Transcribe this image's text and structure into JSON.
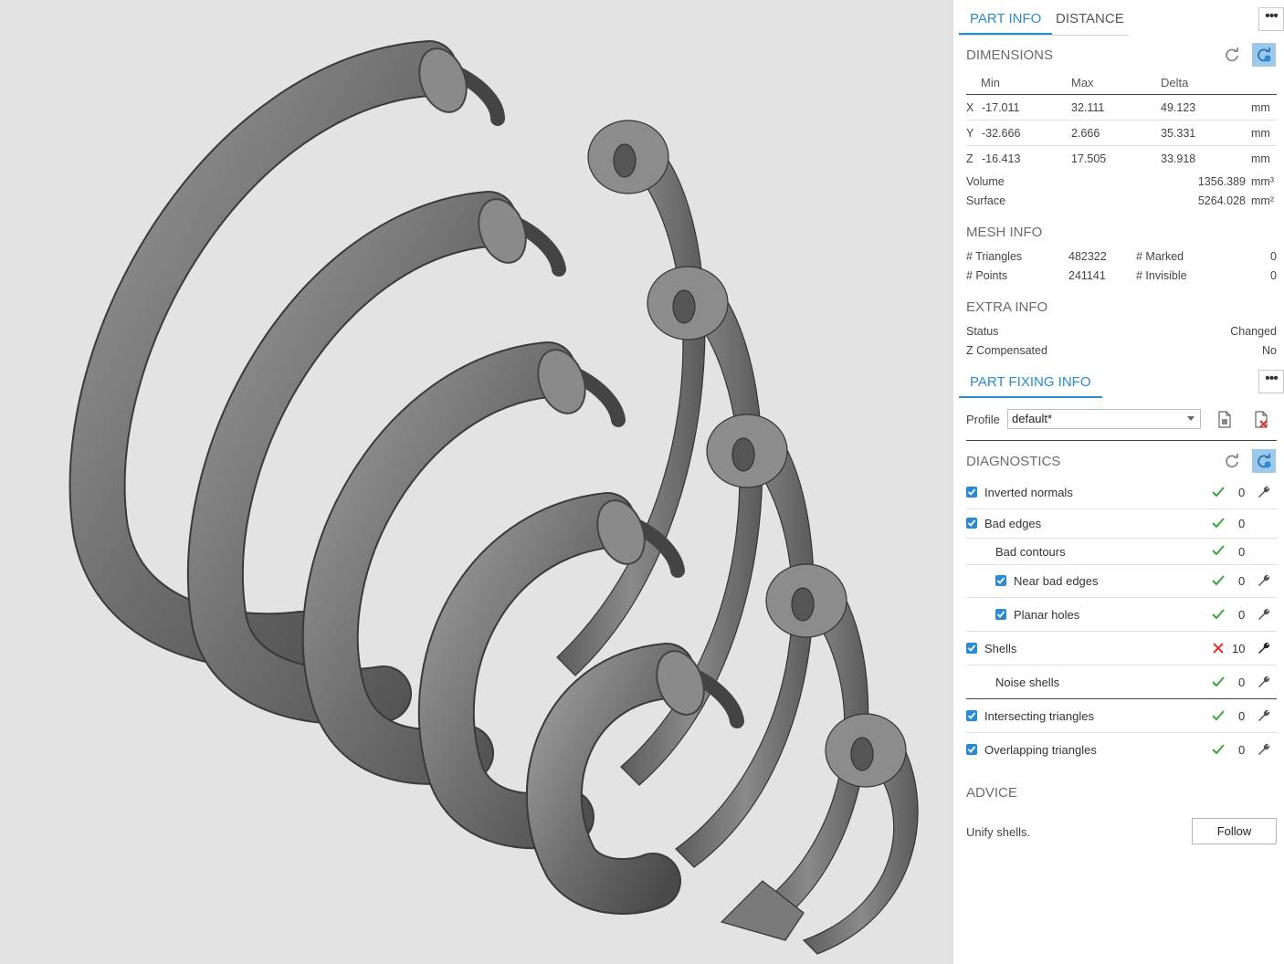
{
  "tabs": {
    "part_info": "PART INFO",
    "distance": "DISTANCE"
  },
  "dimensions": {
    "title": "DIMENSIONS",
    "headers": {
      "min": "Min",
      "max": "Max",
      "delta": "Delta"
    },
    "rows": [
      {
        "axis": "X",
        "min": "-17.011",
        "max": "32.111",
        "delta": "49.123",
        "unit": "mm"
      },
      {
        "axis": "Y",
        "min": "-32.666",
        "max": "2.666",
        "delta": "35.331",
        "unit": "mm"
      },
      {
        "axis": "Z",
        "min": "-16.413",
        "max": "17.505",
        "delta": "33.918",
        "unit": "mm"
      }
    ],
    "volume_label": "Volume",
    "volume_value": "1356.389",
    "volume_unit": "mm³",
    "surface_label": "Surface",
    "surface_value": "5264.028",
    "surface_unit": "mm²"
  },
  "mesh_info": {
    "title": "MESH INFO",
    "triangles_label": "# Triangles",
    "triangles_value": "482322",
    "marked_label": "# Marked",
    "marked_value": "0",
    "points_label": "# Points",
    "points_value": "241141",
    "invisible_label": "# Invisible",
    "invisible_value": "0"
  },
  "extra_info": {
    "title": "EXTRA INFO",
    "status_label": "Status",
    "status_value": "Changed",
    "zcomp_label": "Z Compensated",
    "zcomp_value": "No"
  },
  "part_fixing": {
    "title": "PART FIXING INFO",
    "profile_label": "Profile",
    "profile_value": "default*"
  },
  "diagnostics": {
    "title": "DIAGNOSTICS",
    "items": [
      {
        "label": "Inverted normals",
        "count": "0"
      },
      {
        "label": "Bad edges",
        "count": "0"
      },
      {
        "label": "Bad contours",
        "count": "0"
      },
      {
        "label": "Near bad edges",
        "count": "0"
      },
      {
        "label": "Planar holes",
        "count": "0"
      },
      {
        "label": "Shells",
        "count": "10"
      },
      {
        "label": "Noise shells",
        "count": "0"
      },
      {
        "label": "Intersecting triangles",
        "count": "0"
      },
      {
        "label": "Overlapping triangles",
        "count": "0"
      }
    ]
  },
  "advice": {
    "title": "ADVICE",
    "text": "Unify shells.",
    "button": "Follow"
  },
  "colors": {
    "accent": "#2a8ad4",
    "ok": "#3aa63a",
    "error": "#d9342b"
  }
}
